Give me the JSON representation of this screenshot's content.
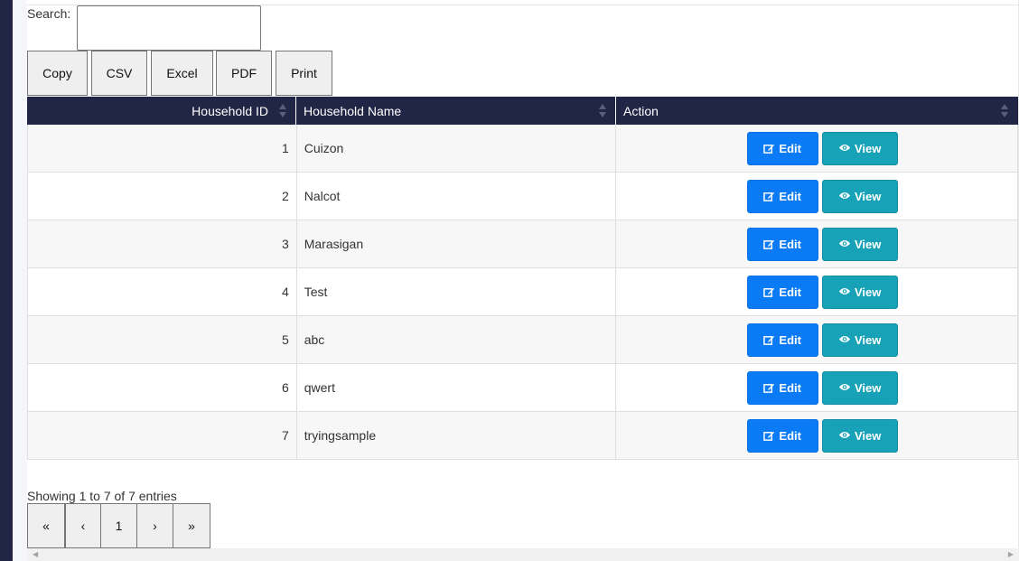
{
  "search": {
    "label": "Search:",
    "value": ""
  },
  "export_buttons": [
    "Copy",
    "CSV",
    "Excel",
    "PDF",
    "Print"
  ],
  "table": {
    "columns": [
      "Household ID",
      "Household Name",
      "Action"
    ],
    "rows": [
      {
        "id": "1",
        "name": "Cuizon"
      },
      {
        "id": "2",
        "name": "Nalcot"
      },
      {
        "id": "3",
        "name": "Marasigan"
      },
      {
        "id": "4",
        "name": "Test"
      },
      {
        "id": "5",
        "name": "abc"
      },
      {
        "id": "6",
        "name": "qwert"
      },
      {
        "id": "7",
        "name": "tryingsample"
      }
    ],
    "edit_label": "Edit",
    "view_label": "View",
    "edit_icon": "edit-icon",
    "view_icon": "eye-icon"
  },
  "info": "Showing 1 to 7 of 7 entries",
  "pagination": {
    "first": "«",
    "prev": "‹",
    "current": "1",
    "next": "›",
    "last": "»"
  },
  "colors": {
    "header_bg": "#222646",
    "edit_btn": "#0a7bf5",
    "view_btn": "#17a2b8"
  }
}
